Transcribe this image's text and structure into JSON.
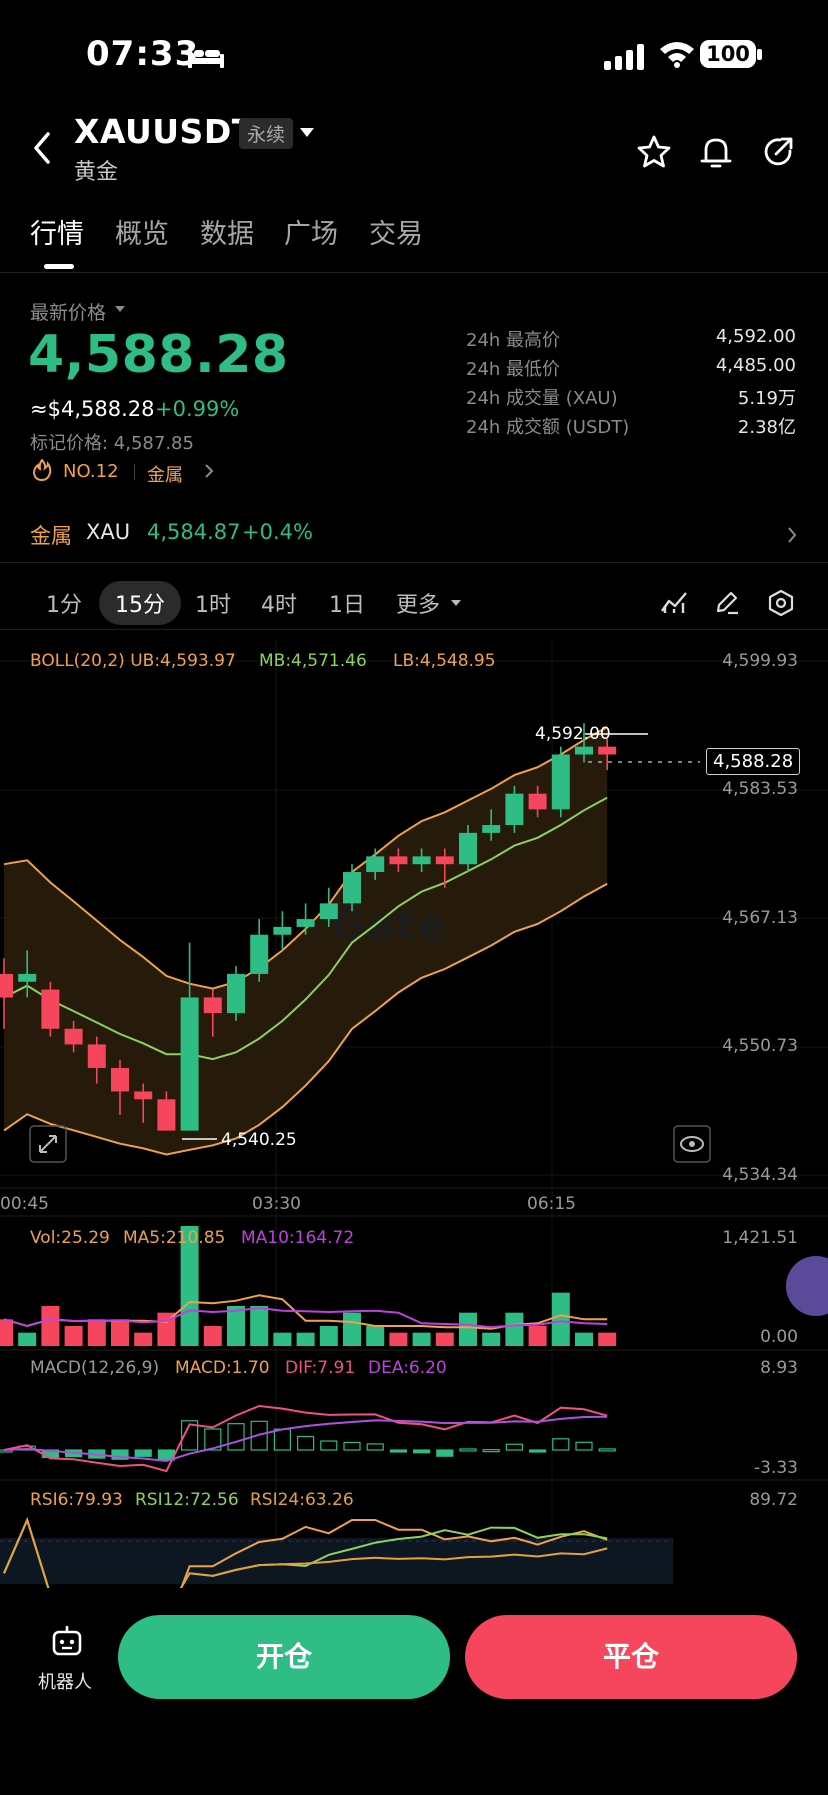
{
  "status_bar": {
    "time": "07:33",
    "battery": "100"
  },
  "header": {
    "symbol": "XAUUSDT",
    "contract": "永续",
    "name_cn": "黄金"
  },
  "tabs": [
    {
      "label": "行情",
      "active": true
    },
    {
      "label": "概览"
    },
    {
      "label": "数据"
    },
    {
      "label": "广场"
    },
    {
      "label": "交易"
    }
  ],
  "price_panel": {
    "label": "最新价格",
    "last_price": "4,588.28",
    "usd_price": "≈$4,588.28",
    "change": "+0.99%",
    "mark_price": "标记价格: 4,587.85",
    "rank": "NO.12",
    "category": "金属",
    "stats": [
      {
        "label": "24h 最高价",
        "value": "4,592.00"
      },
      {
        "label": "24h 最低价",
        "value": "4,485.00"
      },
      {
        "label": "24h 成交量 (XAU)",
        "value": "5.19万"
      },
      {
        "label": "24h 成交额 (USDT)",
        "value": "2.38亿"
      }
    ]
  },
  "related": {
    "category": "金属",
    "symbol": "XAU",
    "price": "4,584.87",
    "change": "+0.4%"
  },
  "intervals": {
    "items": [
      "1分",
      "15分",
      "1时",
      "4时",
      "1日",
      "更多"
    ],
    "active": "15分"
  },
  "indicators": {
    "boll": "BOLL(20,2)",
    "ub": "UB:4,593.97",
    "mb": "MB:4,571.46",
    "lb": "LB:4,548.95",
    "vol": "Vol:25.29",
    "ma5": "MA5:210.85",
    "ma10": "MA10:164.72",
    "macd_label": "MACD(12,26,9)",
    "macd": "MACD:1.70",
    "dif": "DIF:7.91",
    "dea": "DEA:6.20",
    "rsi6": "RSI6:79.93",
    "rsi12": "RSI12:72.56",
    "rsi24": "RSI24:63.26"
  },
  "colors": {
    "up": "#2dbd85",
    "down": "#f6465d",
    "accent": "#f0a24a"
  },
  "chart_data": {
    "type": "candlestick",
    "price_axis": [
      "4,599.93",
      "4,583.53",
      "4,567.13",
      "4,550.73",
      "4,534.34"
    ],
    "price_range": [
      4534.34,
      4599.93
    ],
    "time_labels": [
      "00:45",
      "03:30",
      "06:15"
    ],
    "current_price": "4,588.28",
    "high_label": "4,592.00",
    "low_label": "4,540.25",
    "vol_axis": [
      "1,421.51",
      "0.00"
    ],
    "macd_axis": [
      "8.93",
      "-3.33"
    ],
    "rsi_axis": [
      "89.72"
    ],
    "candles": [
      [
        4560,
        4557,
        4562,
        4553
      ],
      [
        4559,
        4560,
        4563,
        4557
      ],
      [
        4558,
        4553,
        4559,
        4552
      ],
      [
        4553,
        4551,
        4554,
        4550
      ],
      [
        4551,
        4548,
        4552,
        4546
      ],
      [
        4548,
        4545,
        4549,
        4542
      ],
      [
        4545,
        4544,
        4546,
        4541
      ],
      [
        4544,
        4540,
        4545,
        4540
      ],
      [
        4540,
        4557,
        4564,
        4540
      ],
      [
        4557,
        4555,
        4558,
        4552
      ],
      [
        4555,
        4560,
        4561,
        4554
      ],
      [
        4560,
        4565,
        4567,
        4559
      ],
      [
        4565,
        4566,
        4568,
        4563
      ],
      [
        4566,
        4567,
        4569,
        4565
      ],
      [
        4567,
        4569,
        4571,
        4566
      ],
      [
        4569,
        4573,
        4574,
        4568
      ],
      [
        4573,
        4575,
        4576,
        4572
      ],
      [
        4575,
        4574,
        4576,
        4573
      ],
      [
        4574,
        4575,
        4576,
        4573
      ],
      [
        4575,
        4574,
        4576,
        4571
      ],
      [
        4574,
        4578,
        4579,
        4573
      ],
      [
        4578,
        4579,
        4581,
        4577
      ],
      [
        4579,
        4583,
        4584,
        4578
      ],
      [
        4583,
        4581,
        4584,
        4580
      ],
      [
        4581,
        4588,
        4589,
        4580
      ],
      [
        4588,
        4589,
        4592,
        4587
      ],
      [
        4589,
        4588,
        4590,
        4586
      ]
    ]
  }
}
